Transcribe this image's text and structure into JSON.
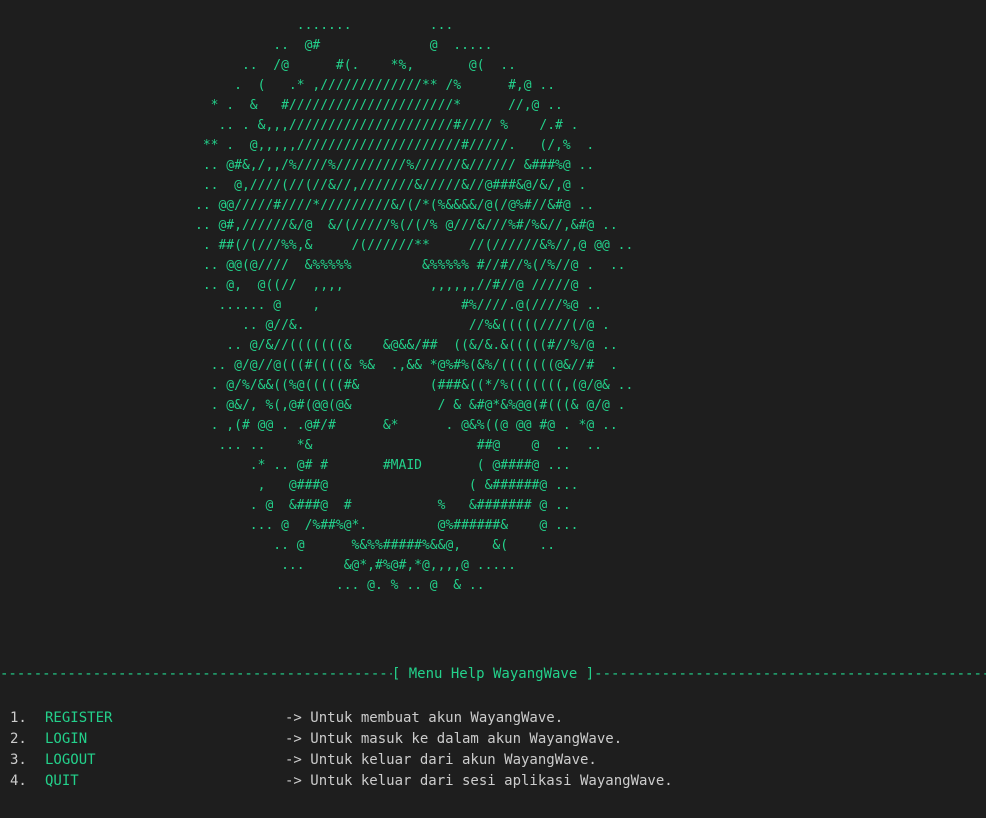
{
  "ascii_art": [
    "             .......          ...",
    "          ..  @#              @  .....",
    "      ..  /@      #(.    *%,       @(  ..",
    "     .  (   .* ,/////////////** /%      #,@ ..",
    "  * .  &   #/////////////////////*      //,@ ..",
    "   .. . &,,,/////////////////////#//// %    /.# .",
    " ** .  @,,,,,/////////////////////#/////.   (/,%  .",
    " .. @#&,/,,/%////%/////////%//////&////// &###%@ ..",
    " ..  @,////(//(//&//,///////&/////&//@###&@/&/,@ .",
    ".. @@/////#////*/////////&/(/*(%&&&&/@(/@%#//&#@ ..",
    ".. @#,//////&/@  &/(/////%(/(/% @///&///%#/%&//,&#@ ..",
    " . ##(/(///%%,&     /(//////**     //(//////&%//,@ @@ ..",
    " .. @@(@////  &%%%%%         &%%%%% #//#//%(/%//@ .  ..",
    " .. @,  @((//  ,,,,           ,,,,,,//#//@ /////@ .",
    "   ...... @    ,                  #%////.@(////%@ ..",
    "      .. @//&.                     //%&(((((////(/@ .",
    "    .. @/&//(((((((&    &@&&/##  ((&/&.&(((((#//%/@ ..",
    "  .. @/@//@(((#((((& %&  .,&& *@%#%(&%/(((((((@&//#  .",
    "  . @/%/&&((%@(((((#&         (###&((*/%(((((((,(@/@& ..",
    "  . @&/, %(,@#(@@(@&           / & &#@*&%@@(#(((& @/@ .",
    "  . ,(# @@ . .@#/#      &*      . @&%((@ @@ #@ . *@ ..",
    "   ... ..    *&                     ##@    @  ..  ..",
    "       .* .. @# #       #MAID       ( @####@ ...",
    "        ,   @###@                  ( &######@ ...",
    "       . @  &###@  #           %   &####### @ ..",
    "       ... @  /%##%@*.         @%######&    @ ...",
    "          .. @      %&%%#####%&&@,    &(    ..",
    "           ...     &@*,#%@#,*@,,,,@ .....",
    "                  ... @. % .. @  & .."
  ],
  "separator": {
    "left_dashes": "--------------------------------------------------------------------------------",
    "title": "[ Menu Help WayangWave ]",
    "right_dashes": "-----------------------------------------------------------------------------------------------------"
  },
  "menu": [
    {
      "num": "1.",
      "cmd": "REGISTER",
      "desc": "-> Untuk membuat akun WayangWave."
    },
    {
      "num": "2.",
      "cmd": "LOGIN",
      "desc": "-> Untuk masuk ke dalam akun WayangWave."
    },
    {
      "num": "3.",
      "cmd": "LOGOUT",
      "desc": "-> Untuk keluar dari akun WayangWave."
    },
    {
      "num": "4.",
      "cmd": "QUIT",
      "desc": "-> Untuk keluar dari sesi aplikasi WayangWave."
    }
  ],
  "colors": {
    "background": "#1e1e1e",
    "accent_green": "#23d18b",
    "text": "#cccccc"
  }
}
